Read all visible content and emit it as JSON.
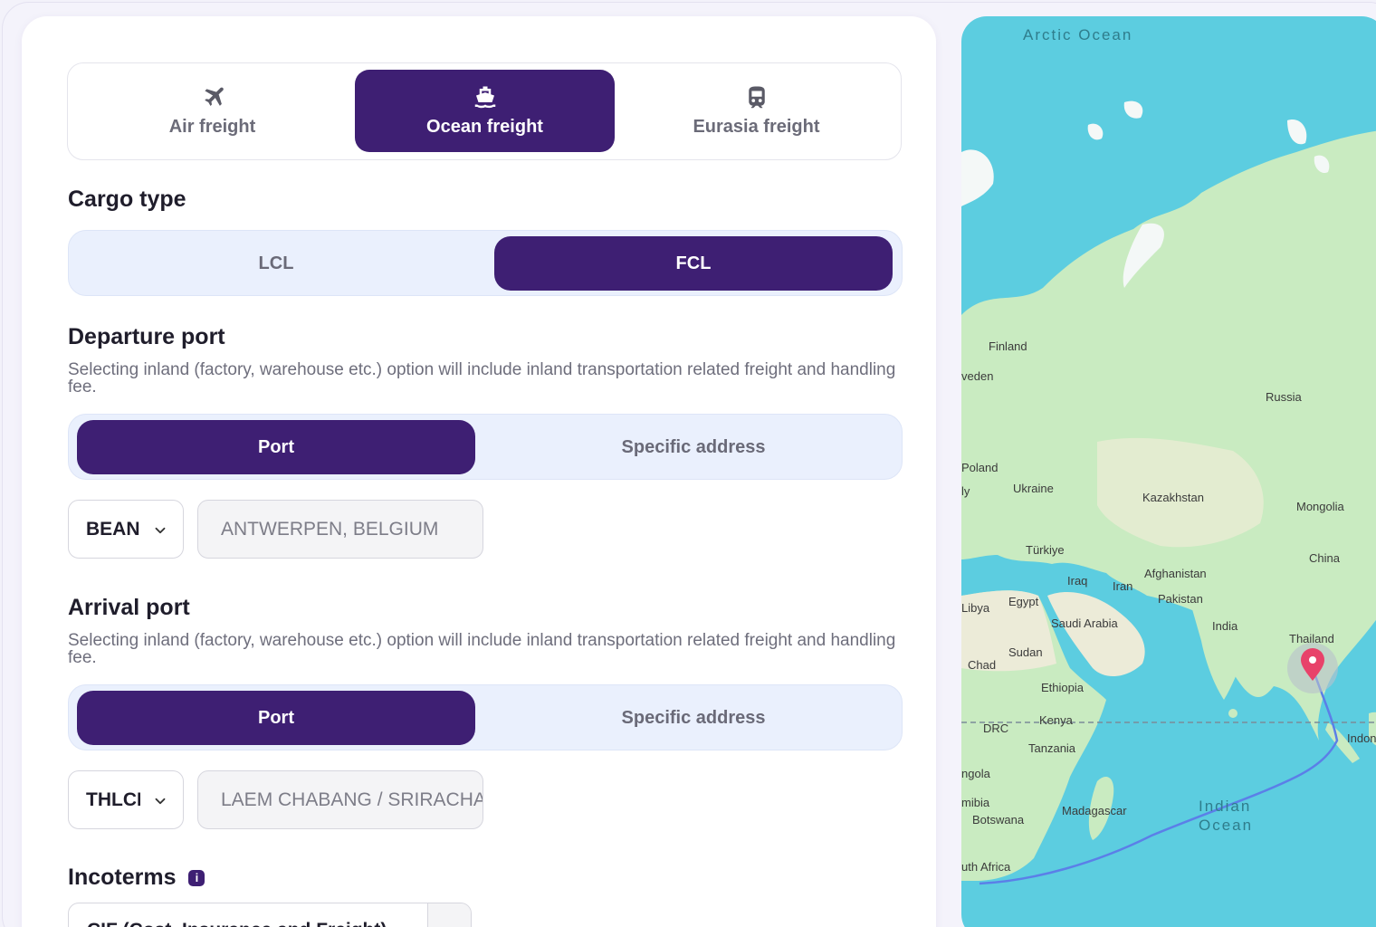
{
  "freight_modes": {
    "air": "Air freight",
    "ocean": "Ocean freight",
    "eurasia": "Eurasia freight",
    "selected": "Ocean freight"
  },
  "cargo_type": {
    "title": "Cargo type",
    "options": [
      "LCL",
      "FCL"
    ],
    "selected": "FCL"
  },
  "departure": {
    "title": "Departure port",
    "hint": "Selecting inland (factory, warehouse etc.) option will include inland transportation related freight and handling fee.",
    "options": [
      "Port",
      "Specific address"
    ],
    "selected": "Port",
    "code": "BEANR",
    "port_name": "ANTWERPEN, BELGIUM"
  },
  "arrival": {
    "title": "Arrival port",
    "hint": "Selecting inland (factory, warehouse etc.) option will include inland transportation related freight and handling fee.",
    "options": [
      "Port",
      "Specific address"
    ],
    "selected": "Port",
    "code": "THLCH",
    "port_name": "LAEM CHABANG / SRIRACHA"
  },
  "incoterms": {
    "title": "Incoterms",
    "value": "CIF (Cost, Insurance and Freight)"
  },
  "map": {
    "oceans": {
      "arctic": "Arctic Ocean",
      "indian_1": "Indian",
      "indian_2": "Ocean"
    },
    "labels": {
      "finland": "Finland",
      "sweden": "veden",
      "russia": "Russia",
      "poland": "Poland",
      "italy": "ly",
      "ukraine": "Ukraine",
      "kazakhstan": "Kazakhstan",
      "mongolia": "Mongolia",
      "turkiye": "Türkiye",
      "china": "China",
      "iraq": "Iraq",
      "afghanistan": "Afghanistan",
      "iran": "Iran",
      "libya": "Libya",
      "egypt": "Egypt",
      "pakistan": "Pakistan",
      "saudi": "Saudi Arabia",
      "india": "India",
      "thailand": "Thailand",
      "sudan": "Sudan",
      "chad": "Chad",
      "ethiopia": "Ethiopia",
      "drc": "DRC",
      "kenya": "Kenya",
      "indonesia": "Indon",
      "tanzania": "Tanzania",
      "angola": "ngola",
      "namibia": "mibia",
      "madagascar": "Madagascar",
      "botswana": "Botswana",
      "south_africa": "uth Africa"
    },
    "colors": {
      "water": "#5ccde0",
      "land": "#c9ebc1",
      "desert": "#ecebd8",
      "route": "#5b7fe8",
      "pin": "#e8426a"
    }
  }
}
